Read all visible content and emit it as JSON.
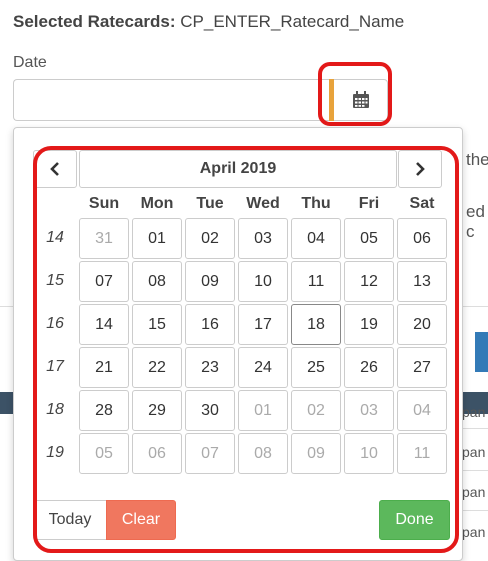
{
  "header": {
    "prefix": "Selected Ratecards:",
    "value": "CP_ENTER_Ratecard_Name"
  },
  "date_field": {
    "label": "Date",
    "value": ""
  },
  "background": {
    "text_right1": "the",
    "text_right2": "ed c",
    "rows": [
      "pan",
      "pan",
      "pan",
      "pan",
      "pan"
    ]
  },
  "calendar": {
    "month_label": "April 2019",
    "days_of_week": [
      "Sun",
      "Mon",
      "Tue",
      "Wed",
      "Thu",
      "Fri",
      "Sat"
    ],
    "weeks": [
      {
        "num": "14",
        "days": [
          {
            "d": "31",
            "m": true
          },
          {
            "d": "01"
          },
          {
            "d": "02"
          },
          {
            "d": "03"
          },
          {
            "d": "04"
          },
          {
            "d": "05"
          },
          {
            "d": "06"
          }
        ]
      },
      {
        "num": "15",
        "days": [
          {
            "d": "07"
          },
          {
            "d": "08"
          },
          {
            "d": "09"
          },
          {
            "d": "10"
          },
          {
            "d": "11"
          },
          {
            "d": "12"
          },
          {
            "d": "13"
          }
        ]
      },
      {
        "num": "16",
        "days": [
          {
            "d": "14"
          },
          {
            "d": "15"
          },
          {
            "d": "16"
          },
          {
            "d": "17"
          },
          {
            "d": "18",
            "t": true
          },
          {
            "d": "19"
          },
          {
            "d": "20"
          }
        ]
      },
      {
        "num": "17",
        "days": [
          {
            "d": "21"
          },
          {
            "d": "22"
          },
          {
            "d": "23"
          },
          {
            "d": "24"
          },
          {
            "d": "25"
          },
          {
            "d": "26"
          },
          {
            "d": "27"
          }
        ]
      },
      {
        "num": "18",
        "days": [
          {
            "d": "28"
          },
          {
            "d": "29"
          },
          {
            "d": "30"
          },
          {
            "d": "01",
            "m": true
          },
          {
            "d": "02",
            "m": true
          },
          {
            "d": "03",
            "m": true
          },
          {
            "d": "04",
            "m": true
          }
        ]
      },
      {
        "num": "19",
        "days": [
          {
            "d": "05",
            "m": true
          },
          {
            "d": "06",
            "m": true
          },
          {
            "d": "07",
            "m": true
          },
          {
            "d": "08",
            "m": true
          },
          {
            "d": "09",
            "m": true
          },
          {
            "d": "10",
            "m": true
          },
          {
            "d": "11",
            "m": true
          }
        ]
      }
    ],
    "buttons": {
      "today": "Today",
      "clear": "Clear",
      "done": "Done"
    }
  },
  "colors": {
    "highlight": "#e31919",
    "accent": "#e8a33b",
    "clear": "#f0775f",
    "done": "#5cb85c"
  },
  "icons": {
    "calendar": "calendar-icon",
    "prev": "chevron-left-icon",
    "next": "chevron-right-icon"
  }
}
